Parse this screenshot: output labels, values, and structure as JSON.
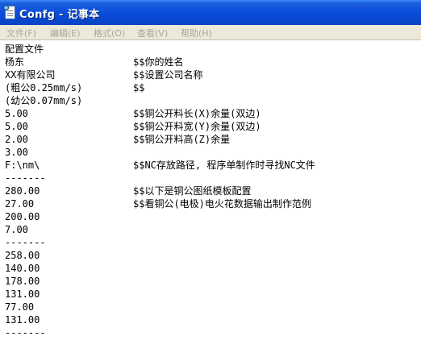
{
  "window": {
    "title": "Confg - 记事本"
  },
  "menu": [
    {
      "label": "文件(F)"
    },
    {
      "label": "编辑(E)"
    },
    {
      "label": "格式(O)"
    },
    {
      "label": "查看(V)"
    },
    {
      "label": "帮助(H)"
    }
  ],
  "lines": [
    {
      "left": "配置文件",
      "right": ""
    },
    {
      "left": "杨东",
      "right": "$$你的姓名"
    },
    {
      "left": "XX有限公司",
      "right": "$$设置公司名称"
    },
    {
      "left": "(粗公0.25mm/s)",
      "right": "$$"
    },
    {
      "left": "(幼公0.07mm/s)",
      "right": ""
    },
    {
      "left": "5.00",
      "right": "$$铜公开料长(X)余量(双边)"
    },
    {
      "left": "5.00",
      "right": "$$铜公开料宽(Y)余量(双边)"
    },
    {
      "left": "2.00",
      "right": "$$铜公开料高(Z)余量"
    },
    {
      "left": "3.00",
      "right": ""
    },
    {
      "left": "F:\\nm\\",
      "right": "$$NC存放路径, 程序单制作时寻找NC文件"
    },
    {
      "left": "-------",
      "right": ""
    },
    {
      "left": "280.00",
      "right": "$$以下是铜公图纸模板配置"
    },
    {
      "left": "27.00",
      "right": "$$看铜公(电极)电火花数据输出制作范例"
    },
    {
      "left": "200.00",
      "right": ""
    },
    {
      "left": "7.00",
      "right": ""
    },
    {
      "left": "-------",
      "right": ""
    },
    {
      "left": "258.00",
      "right": ""
    },
    {
      "left": "140.00",
      "right": ""
    },
    {
      "left": "178.00",
      "right": ""
    },
    {
      "left": "131.00",
      "right": ""
    },
    {
      "left": "77.00",
      "right": ""
    },
    {
      "left": "131.00",
      "right": ""
    },
    {
      "left": "-------",
      "right": ""
    }
  ]
}
